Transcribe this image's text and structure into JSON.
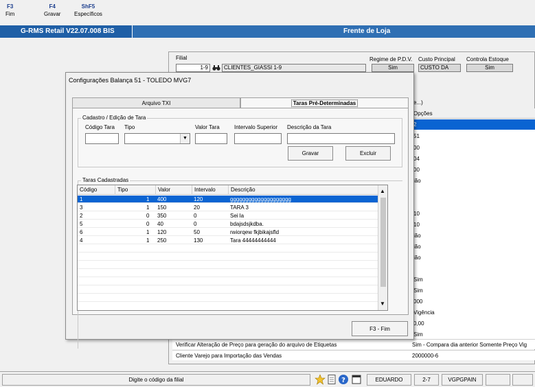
{
  "fkeys": [
    {
      "key": "F3",
      "label": "Fim"
    },
    {
      "key": "F4",
      "label": "Gravar"
    },
    {
      "key": "ShF5",
      "label": "Específicos"
    }
  ],
  "titlebar": {
    "app": "G-RMS Retail V22.07.008 BIS",
    "module": "Frente de Loja"
  },
  "bg_form": {
    "filial_label": "Filial",
    "filial_code": "1-9",
    "filial_name": "CLIENTES_GIASSI 1-9",
    "regime_label": "Regime de P.D.V.",
    "regime_value": "Sim",
    "custo_label": "Custo Principal",
    "custo_value": "CUSTO DA",
    "estoque_label": "Controla Estoque",
    "estoque_value": "Sim",
    "partial_tab": "e...)",
    "opcoes_header": "Opções",
    "opcoes": [
      "2",
      "51",
      "00",
      "04",
      "00",
      "ião",
      "",
      "",
      "10",
      "10",
      "ião",
      "ião",
      "ião",
      "",
      "Sim",
      "Sim",
      "000",
      "Vigência",
      "0,00",
      "Sim"
    ],
    "bottom_rows": [
      {
        "desc": "Verificar Alteração de Preço para geração do arquivo de Etiquetas",
        "value": "Sim - Compara dia anterior Somente Preço Vig"
      },
      {
        "desc": "Cliente Varejo para Importação das Vendas",
        "value": "2000000-6"
      }
    ]
  },
  "dialog": {
    "title": "Configurações Balança 51 - TOLEDO MVG7",
    "tabs": [
      "Arquivo TXI",
      "Taras Pré-Determinadas"
    ],
    "cadastro_title": "Cadastro / Edição de Tara",
    "field_labels": {
      "codigo": "Código Tara",
      "tipo": "Tipo",
      "valor": "Valor Tara",
      "intervalo": "Intervalo Superior",
      "descricao": "Descrição da Tara"
    },
    "gravar": "Gravar",
    "excluir": "Excluir",
    "lista_title": "Taras Cadastradas",
    "columns": [
      "Código",
      "Tipo",
      "Valor",
      "Intervalo",
      "Descrição"
    ],
    "rows": [
      {
        "codigo": "1",
        "tipo": "1",
        "valor": "400",
        "intervalo": "120",
        "descricao": "gggggggggggggggggggg"
      },
      {
        "codigo": "3",
        "tipo": "1",
        "valor": "150",
        "intervalo": "20",
        "descricao": "TARA 3"
      },
      {
        "codigo": "2",
        "tipo": "0",
        "valor": "350",
        "intervalo": "0",
        "descricao": "Sei la"
      },
      {
        "codigo": "5",
        "tipo": "0",
        "valor": "40",
        "intervalo": "0",
        "descricao": "bdajsdsjkdba."
      },
      {
        "codigo": "6",
        "tipo": "1",
        "valor": "120",
        "intervalo": "50",
        "descricao": "rwiorqew fkjbikajsfld"
      },
      {
        "codigo": "4",
        "tipo": "1",
        "valor": "250",
        "intervalo": "130",
        "descricao": "Tara 44444444444"
      }
    ],
    "fim_button": "F3 - Fim"
  },
  "status": {
    "message": "Digite o código da filial",
    "user": "EDUARDO",
    "store": "2-7",
    "host": "VGPGPAIN"
  },
  "colors": {
    "titlebar": "#2f6fb3",
    "selection": "#0a64d2",
    "fkey": "#1a3c8c"
  }
}
